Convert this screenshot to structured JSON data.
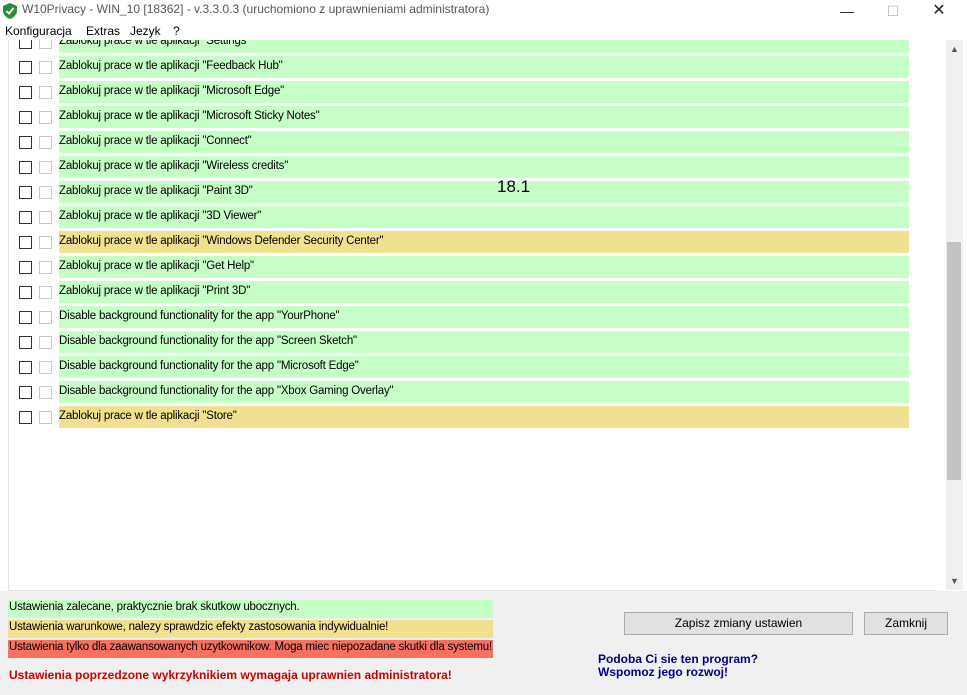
{
  "window": {
    "title": "W10Privacy - WIN_10 [18362]  - v.3.3.0.3 (uruchomiono z uprawnieniami administratora)",
    "minimize_glyph": "—",
    "maximize_glyph": "☐",
    "close_glyph": "✕",
    "icon": "shield-check-icon"
  },
  "menu": {
    "items": [
      "Konfiguracja",
      "Extras",
      "Jezyk",
      "?"
    ]
  },
  "overlay_number": "18.1",
  "rows": [
    {
      "label": "Zablokuj prace w tle aplikacji \"Settings\"",
      "color": "green"
    },
    {
      "label": "Zablokuj prace w tle aplikacji \"Feedback Hub\"",
      "color": "green"
    },
    {
      "label": "Zablokuj prace w tle aplikacji \"Microsoft Edge\"",
      "color": "green"
    },
    {
      "label": "Zablokuj prace w tle aplikacji \"Microsoft Sticky Notes\"",
      "color": "green"
    },
    {
      "label": "Zablokuj prace w tle aplikacji \"Connect\"",
      "color": "green"
    },
    {
      "label": "Zablokuj prace w tle aplikacji \"Wireless credits\"",
      "color": "green"
    },
    {
      "label": "Zablokuj prace w tle aplikacji \"Paint 3D\"",
      "color": "green"
    },
    {
      "label": "Zablokuj prace w tle aplikacji \"3D Viewer\"",
      "color": "green"
    },
    {
      "label": "Zablokuj prace w tle aplikacji \"Windows Defender Security Center\"",
      "color": "yellow"
    },
    {
      "label": "Zablokuj prace w tle aplikacji \"Get Help\"",
      "color": "green"
    },
    {
      "label": "Zablokuj prace w tle aplikacji \"Print 3D\"",
      "color": "green"
    },
    {
      "label": "Disable background functionality for the app \"YourPhone\"",
      "color": "green"
    },
    {
      "label": "Disable background functionality for the app \"Screen Sketch\"",
      "color": "green"
    },
    {
      "label": "Disable background functionality for the app \"Microsoft Edge\"",
      "color": "green"
    },
    {
      "label": "Disable background functionality for the app \"Xbox Gaming Overlay\"",
      "color": "green"
    },
    {
      "label": "Zablokuj prace w tle aplikacji \"Store\"",
      "color": "yellow"
    }
  ],
  "legend": {
    "green": "Ustawienia zalecane, praktycznie brak skutkow ubocznych.",
    "yellow": "Ustawienia warunkowe, nalezy sprawdzic efekty zastosowania indywidualnie!",
    "red": "Ustawienia tylko dla zaawansowanych uzytkownikow. Moga miec niepozadane skutki dla systemu!"
  },
  "admin_warning": "Ustawienia poprzedzone wykrzyknikiem wymagaja uprawnien administratora!",
  "buttons": {
    "save": "Zapisz zmiany ustawien",
    "close": "Zamknij"
  },
  "support": {
    "line1": "Podoba Ci sie ten program?",
    "line2": "Wspomoz jego rozwoj!"
  },
  "colors": {
    "green": "#c6ffc6",
    "yellow": "#f0e090",
    "red": "#f87060",
    "warning": "#cc0000",
    "support_link": "#00008b"
  }
}
